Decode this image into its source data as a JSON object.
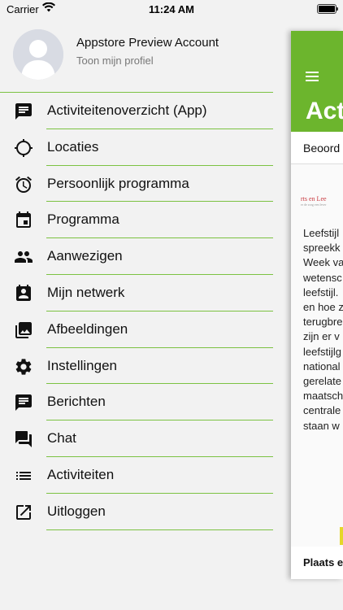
{
  "status_bar": {
    "carrier": "Carrier",
    "time": "11:24 AM"
  },
  "profile": {
    "name": "Appstore Preview Account",
    "subtitle": "Toon mijn profiel"
  },
  "menu": [
    {
      "label": "Activiteitenoverzicht (App)",
      "icon": "message-icon"
    },
    {
      "label": "Locaties",
      "icon": "crosshair-icon"
    },
    {
      "label": "Persoonlijk programma",
      "icon": "alarm-icon"
    },
    {
      "label": "Programma",
      "icon": "calendar-icon"
    },
    {
      "label": "Aanwezigen",
      "icon": "people-icon"
    },
    {
      "label": "Mijn netwerk",
      "icon": "contact-card-icon"
    },
    {
      "label": "Afbeeldingen",
      "icon": "images-icon"
    },
    {
      "label": "Instellingen",
      "icon": "gear-icon"
    },
    {
      "label": "Berichten",
      "icon": "message-text-icon"
    },
    {
      "label": "Chat",
      "icon": "chat-icon"
    },
    {
      "label": "Activiteiten",
      "icon": "list-icon"
    },
    {
      "label": "Uitloggen",
      "icon": "open-external-icon"
    }
  ],
  "panel": {
    "title": "Act",
    "tab": "Beoord",
    "logo_text": "rts en Lee",
    "logo_sub": "er de zorg een lever",
    "body_lines": [
      "Leefstijl",
      "spreekk",
      "Week va",
      "wetensc",
      "leefstijl.",
      "en hoe z",
      "terugbre",
      "zijn er v",
      "leefstijlg",
      "national",
      "gerelate",
      "maatsch",
      "centrale",
      "staan w"
    ],
    "footer": "Plaats e"
  },
  "colors": {
    "accent": "#6cb52d",
    "divider": "#7cc242",
    "background": "#f2f2f2"
  }
}
